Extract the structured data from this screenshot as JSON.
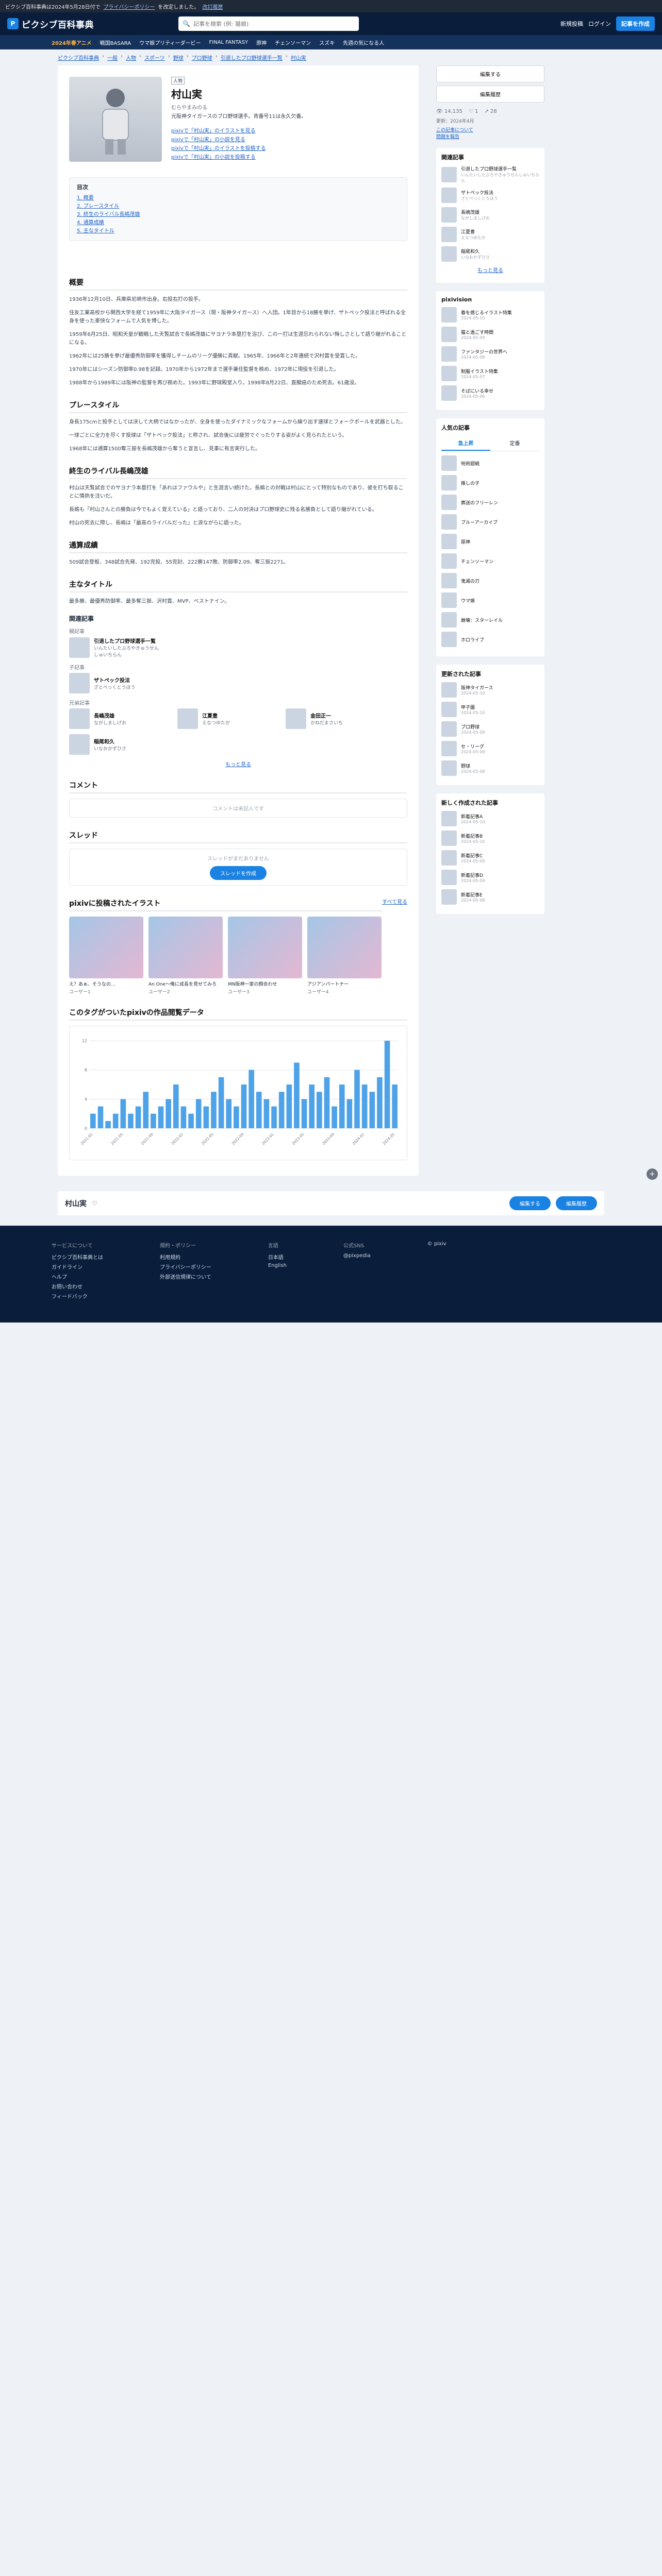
{
  "notice": {
    "text": "ピクシブ百科事典は2024年5月28日付で",
    "link": "プライバシーポリシー",
    "text2": "を改定しました。",
    "link2": "改訂履歴"
  },
  "header": {
    "logo": "ピクシブ百科事典",
    "search_placeholder": "記事を検索 (例: 猫娘)",
    "new_article": "新規投稿",
    "login": "ログイン",
    "create": "記事を作成"
  },
  "subnav": [
    "2024年春アニメ",
    "戦国BASARA",
    "ウマ娘プリティーダービー",
    "FINAL FANTASY",
    "原神",
    "チェンソーマン",
    "スズキ",
    "先週の気になる人"
  ],
  "breadcrumb": [
    "ピクシブ百科事典",
    "一般",
    "人物",
    "スポーツ",
    "野球",
    "プロ野球",
    "引退したプロ野球選手一覧",
    "村山実"
  ],
  "article": {
    "tag": "人物",
    "title": "村山実",
    "reading": "むらやまみのる",
    "summary": "元阪神タイガースのプロ野球選手。背番号11は永久欠番。",
    "links": [
      "pixivで「村山実」のイラストを見る",
      "pixivで「村山実」の小説を見る",
      "pixivで「村山実」のイラストを投稿する",
      "pixivで「村山実」の小説を投稿する"
    ],
    "toc_title": "目次",
    "toc": [
      "1. 概要",
      "2. プレースタイル",
      "3. 終生のライバル長嶋茂雄",
      "4. 通算成績",
      "5. 主なタイトル"
    ],
    "sections": [
      {
        "title": "概要",
        "paras": [
          "1936年12月10日、兵庫県尼崎市出身。右投右打の投手。",
          "住友工業高校から関西大学を経て1959年に大阪タイガース（現・阪神タイガース）へ入団。1年目から18勝を挙げ、ザトペック投法と呼ばれる全身を使った豪快なフォームで人気を博した。",
          "1959年6月25日、昭和天皇が観戦した天覧試合で長嶋茂雄にサヨナラ本塁打を浴び、この一打は生涯忘れられない悔しさとして語り継がれることになる。",
          "1962年には25勝を挙げ最優秀防御率を獲得しチームのリーグ優勝に貢献。1965年、1966年と2年連続で沢村賞を受賞した。",
          "1970年にはシーズン防御率0.98を記録。1970年から1972年まで選手兼任監督を務め、1972年に現役を引退した。",
          "1988年から1989年には阪神の監督を再び務めた。1993年に野球殿堂入り。1998年8月22日、直腸癌のため死去。61歳没。"
        ]
      },
      {
        "title": "プレースタイル",
        "paras": [
          "身長175cmと投手としては決して大柄ではなかったが、全身を使ったダイナミックなフォームから繰り出す速球とフォークボールを武器とした。",
          "一球ごとに全力を尽くす投球は「ザトペック投法」と称され、試合後には疲労でぐったりする姿がよく見られたという。",
          "1968年には通算1500奪三振を長嶋茂雄から奪うと宣言し、見事に有言実行した。"
        ]
      },
      {
        "title": "終生のライバル長嶋茂雄",
        "paras": [
          "村山は天覧試合でのサヨナラ本塁打を「あれはファウルや」と生涯言い続けた。長嶋との対戦は村山にとって特別なものであり、彼を打ち取ることに情熱を注いだ。",
          "長嶋も「村山さんとの勝負は今でもよく覚えている」と語っており、二人の対決はプロ野球史に残る名勝負として語り継がれている。",
          "村山の死去に際し、長嶋は「最高のライバルだった」と涙ながらに語った。"
        ]
      },
      {
        "title": "通算成績",
        "paras": [
          "509試合登板、348試合先発、192完投、55完封、222勝147敗、防御率2.09、奪三振2271。"
        ]
      },
      {
        "title": "主なタイトル",
        "paras": [
          "最多勝、最優秀防御率、最多奪三振、沢村賞、MVP、ベストナイン。"
        ]
      }
    ]
  },
  "related": {
    "title": "関連記事",
    "groups": [
      {
        "label": "親記事",
        "items": [
          {
            "t": "引退したプロ野球選手一覧",
            "s": "いんたいしたぷろやきゅうせんしゅいちらん"
          }
        ]
      },
      {
        "label": "子記事",
        "items": [
          {
            "t": "ザトペック投法",
            "s": "ざとぺっくとうほう"
          }
        ]
      },
      {
        "label": "兄弟記事",
        "items": [
          {
            "t": "長嶋茂雄",
            "s": "ながしましげお"
          },
          {
            "t": "江夏豊",
            "s": "えなつゆたか"
          },
          {
            "t": "金田正一",
            "s": "かねだまさいち"
          },
          {
            "t": "稲尾和久",
            "s": "いなおかずひさ"
          }
        ]
      }
    ],
    "more": "もっと見る"
  },
  "comments": {
    "title": "コメント",
    "placeholder": "コメントは未記入です"
  },
  "threads": {
    "title": "スレッド",
    "placeholder": "スレッドがまだありません",
    "button": "スレッドを作成"
  },
  "illusts": {
    "title": "pixivに投稿されたイラスト",
    "more": "すべて見る",
    "items": [
      {
        "t": "え？あぁ、そうなの…",
        "u": "ユーザー1"
      },
      {
        "t": "An One〜俺に成長を見せてみろ",
        "u": "ユーザー2"
      },
      {
        "t": "MN阪神一家の顔合わせ",
        "u": "ユーザー3"
      },
      {
        "t": "アジアンパートナー",
        "u": "ユーザー4"
      }
    ]
  },
  "chart_section_title": "このタグがついたpixivの作品閲覧データ",
  "chart_data": {
    "type": "bar",
    "title": "",
    "xlabel": "",
    "ylabel": "",
    "legend": "top-right",
    "series_name": "",
    "categories": [
      "2021-01",
      "2021-02",
      "2021-03",
      "2021-04",
      "2021-05",
      "2021-06",
      "2021-07",
      "2021-08",
      "2021-09",
      "2021-10",
      "2021-11",
      "2021-12",
      "2022-01",
      "2022-02",
      "2022-03",
      "2022-04",
      "2022-05",
      "2022-06",
      "2022-07",
      "2022-08",
      "2022-09",
      "2022-10",
      "2022-11",
      "2022-12",
      "2023-01",
      "2023-02",
      "2023-03",
      "2023-04",
      "2023-05",
      "2023-06",
      "2023-07",
      "2023-08",
      "2023-09",
      "2023-10",
      "2023-11",
      "2023-12",
      "2024-01",
      "2024-02",
      "2024-03",
      "2024-04",
      "2024-05"
    ],
    "values": [
      2,
      3,
      1,
      2,
      4,
      2,
      3,
      5,
      2,
      3,
      4,
      6,
      3,
      2,
      4,
      3,
      5,
      7,
      4,
      3,
      6,
      8,
      5,
      4,
      3,
      5,
      6,
      9,
      4,
      6,
      5,
      7,
      3,
      6,
      4,
      8,
      6,
      5,
      7,
      12,
      6
    ],
    "ylim": [
      0,
      12
    ]
  },
  "side": {
    "edit": "編集する",
    "history": "編集履歴",
    "stats": [
      "14,135",
      "1",
      "28"
    ],
    "update": "更新：2024年4月",
    "links": [
      "この記事について",
      "問題を報告"
    ],
    "related_title": "関連記事",
    "related": [
      {
        "t": "引退したプロ野球選手一覧",
        "s": "いんたいしたぷろやきゅうせんしゅいちらん"
      },
      {
        "t": "ザトペック投法",
        "s": "ざとぺっくとうほう"
      },
      {
        "t": "長嶋茂雄",
        "s": "ながしましげお"
      },
      {
        "t": "江夏豊",
        "s": "えなつゆたか"
      },
      {
        "t": "稲尾和久",
        "s": "いなおかずひさ"
      }
    ],
    "more": "もっと見る",
    "pixivision_title": "pixivision",
    "pixivision": [
      {
        "t": "春を感じるイラスト特集",
        "s": "2024-05-10"
      },
      {
        "t": "猫と過ごす時間",
        "s": "2024-05-09"
      },
      {
        "t": "ファンタジーの世界へ",
        "s": "2024-05-08"
      },
      {
        "t": "制服イラスト特集",
        "s": "2024-05-07"
      },
      {
        "t": "そばにいる幸せ",
        "s": "2024-05-06"
      }
    ],
    "popular_title": "人気の記事",
    "tabs": [
      "急上昇",
      "定番"
    ],
    "popular": [
      "呪術廻戦",
      "推しの子",
      "葬送のフリーレン",
      "ブルーアーカイブ",
      "原神",
      "チェンソーマン",
      "鬼滅の刃",
      "ウマ娘",
      "崩壊：スターレイル",
      "ホロライブ"
    ],
    "updated_title": "更新された記事",
    "updated": [
      {
        "t": "阪神タイガース",
        "s": "2024-05-10"
      },
      {
        "t": "甲子園",
        "s": "2024-05-10"
      },
      {
        "t": "プロ野球",
        "s": "2024-05-09"
      },
      {
        "t": "セ・リーグ",
        "s": "2024-05-09"
      },
      {
        "t": "野球",
        "s": "2024-05-08"
      }
    ],
    "new_title": "新しく作成された記事",
    "new": [
      {
        "t": "新着記事A",
        "s": "2024-05-10"
      },
      {
        "t": "新着記事B",
        "s": "2024-05-10"
      },
      {
        "t": "新着記事C",
        "s": "2024-05-09"
      },
      {
        "t": "新着記事D",
        "s": "2024-05-09"
      },
      {
        "t": "新着記事E",
        "s": "2024-05-08"
      }
    ]
  },
  "footbar": {
    "name": "村山実",
    "edit": "編集する",
    "history": "編集履歴"
  },
  "footer": {
    "cols": [
      {
        "h": "サービスについて",
        "items": [
          "ピクシブ百科事典とは",
          "ガイドライン",
          "ヘルプ",
          "お問い合わせ",
          "フィードバック"
        ]
      },
      {
        "h": "規約・ポリシー",
        "items": [
          "利用規約",
          "プライバシーポリシー",
          "外部送信規律について"
        ]
      },
      {
        "h": "言語",
        "items": [
          "日本語",
          "English"
        ]
      },
      {
        "h": "公式SNS",
        "items": [
          "@pixpedia"
        ]
      }
    ],
    "copyright": "© pixiv"
  }
}
